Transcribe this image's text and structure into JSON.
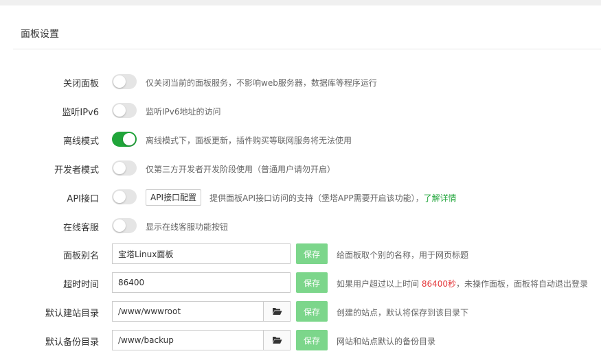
{
  "panel": {
    "title": "面板设置"
  },
  "toggles": [
    {
      "label": "关闭面板",
      "on": false,
      "desc": "仅关闭当前的面板服务，不影响web服务器，数据库等程序运行"
    },
    {
      "label": "监听IPv6",
      "on": false,
      "desc": "监听IPv6地址的访问"
    },
    {
      "label": "离线模式",
      "on": true,
      "desc": "离线模式下，面板更新，插件购买等联网服务将无法使用"
    },
    {
      "label": "开发者模式",
      "on": false,
      "desc": "仅第三方开发者开发阶段使用（普通用户请勿开启）"
    },
    {
      "label": "API接口",
      "on": false,
      "button": "API接口配置",
      "desc": "提供面板API接口访问的支持（堡塔APP需要开启该功能），",
      "link": "了解详情"
    },
    {
      "label": "在线客服",
      "on": false,
      "desc": "显示在线客服功能按钮"
    }
  ],
  "inputs": [
    {
      "label": "面板别名",
      "value": "宝塔Linux面板",
      "save": "保存",
      "desc": "给面板取个别的名称，用于网页标题"
    },
    {
      "label": "超时时间",
      "value": "86400",
      "save": "保存",
      "desc_pre": "如果用户超过以上时间",
      "desc_highlight": "86400秒",
      "desc_post": "，未操作面板，面板将自动退出登录"
    },
    {
      "label": "默认建站目录",
      "value": "/www/wwwroot",
      "save": "保存",
      "desc": "创建的站点，默认将保存到该目录下"
    },
    {
      "label": "默认备份目录",
      "value": "/www/backup",
      "save": "保存",
      "desc": "网站和站点默认的备份目录"
    }
  ],
  "icons": {
    "folder": "folder-open-icon"
  },
  "colors": {
    "accent": "#20a53a",
    "save": "#7cd68b",
    "highlight": "#e4393c"
  }
}
